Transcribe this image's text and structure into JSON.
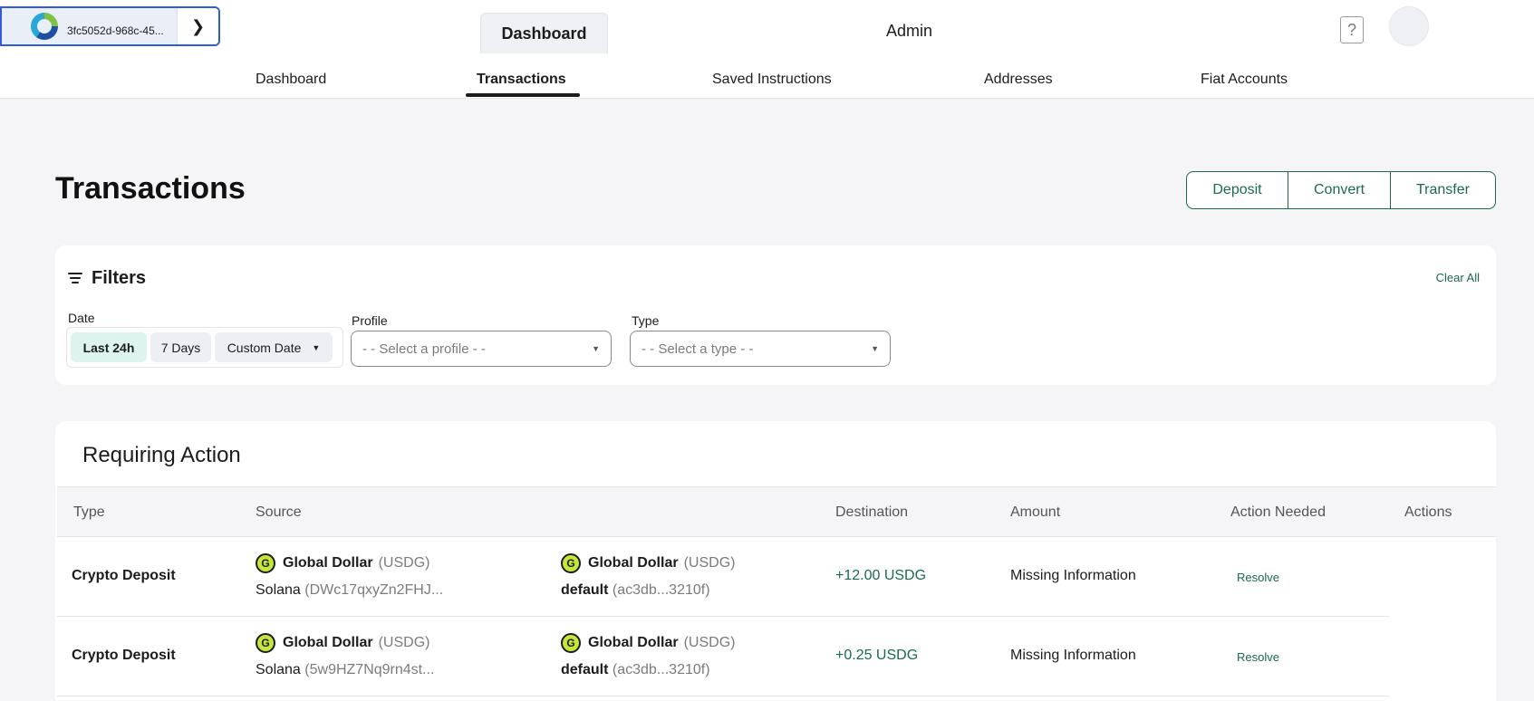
{
  "header": {
    "org_name": "3fc5052d-968c-45...",
    "tabs": [
      {
        "label": "Dashboard"
      },
      {
        "label": "Admin"
      }
    ],
    "help_glyph": "?"
  },
  "subnav": {
    "items": [
      {
        "label": "Dashboard"
      },
      {
        "label": "Transactions"
      },
      {
        "label": "Saved Instructions"
      },
      {
        "label": "Addresses"
      },
      {
        "label": "Fiat Accounts"
      }
    ],
    "active": "Transactions"
  },
  "page": {
    "title": "Transactions"
  },
  "actions": [
    {
      "label": "Deposit"
    },
    {
      "label": "Convert"
    },
    {
      "label": "Transfer"
    }
  ],
  "filters": {
    "title": "Filters",
    "clear_all": "Clear All",
    "date": {
      "label": "Date",
      "options": [
        {
          "label": "Last 24h",
          "selected": true
        },
        {
          "label": "7 Days"
        },
        {
          "label": "Custom Date"
        }
      ]
    },
    "profile": {
      "label": "Profile",
      "placeholder": "- - Select a profile - -"
    },
    "type": {
      "label": "Type",
      "placeholder": "- - Select a type - -"
    }
  },
  "requiring_action": {
    "title": "Requiring Action",
    "columns": [
      "Type",
      "Source",
      "Destination",
      "Amount",
      "Action Needed",
      "Actions"
    ],
    "rows": [
      {
        "type": "Crypto Deposit",
        "source_asset": "Global Dollar",
        "source_ticker": "(USDG)",
        "source_chain": "Solana",
        "source_address": "(DWc17qxyZn2FHJ...",
        "dest_asset": "Global Dollar",
        "dest_ticker": "(USDG)",
        "dest_name": "default",
        "dest_id": "(ac3db...3210f)",
        "amount": "+12.00 USDG",
        "action_needed": "Missing Information",
        "action": "Resolve"
      },
      {
        "type": "Crypto Deposit",
        "source_asset": "Global Dollar",
        "source_ticker": "(USDG)",
        "source_chain": "Solana",
        "source_address": "(5w9HZ7Nq9rn4st...",
        "dest_asset": "Global Dollar",
        "dest_ticker": "(USDG)",
        "dest_name": "default",
        "dest_id": "(ac3db...3210f)",
        "amount": "+0.25 USDG",
        "action_needed": "Missing Information",
        "action": "Resolve"
      }
    ]
  },
  "icons": {
    "coin": "global-dollar-icon",
    "filter": "filter-lines-icon",
    "chevron": "chevron-right-icon",
    "dropdown": "caret-down-icon",
    "help": "help-icon"
  },
  "colors": {
    "accent": "#1b6a4a",
    "selected_chip": "#dcf3ee",
    "org_border": "#2f5bd6",
    "coin": "#c5e63a"
  }
}
